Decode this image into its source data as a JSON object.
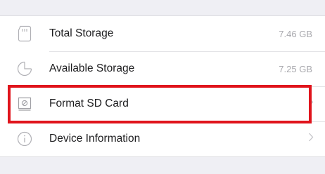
{
  "settings": {
    "items": [
      {
        "label": "Total Storage",
        "value": "7.46 GB",
        "icon": "sd-card-icon"
      },
      {
        "label": "Available Storage",
        "value": "7.25 GB",
        "icon": "pie-chart-icon"
      },
      {
        "label": "Format SD Card",
        "icon": "format-icon",
        "has_chevron": true
      },
      {
        "label": "Device Information",
        "icon": "info-icon",
        "has_chevron": true
      }
    ]
  },
  "colors": {
    "background": "#efeff4",
    "row_background": "#ffffff",
    "highlight": "#e0141c",
    "secondary_text": "#a8a8ad"
  }
}
